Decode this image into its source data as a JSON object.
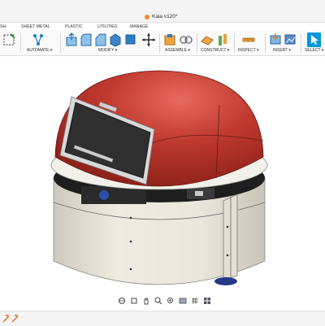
{
  "app": {
    "document_title": "Kaia v120*",
    "accent_color": "#0696d7"
  },
  "tabs": [
    {
      "label": "SH"
    },
    {
      "label": "SHEET METAL"
    },
    {
      "label": "PLASTIC"
    },
    {
      "label": "UTILITIES"
    },
    {
      "label": "MANAGE"
    }
  ],
  "toolbar_groups": [
    {
      "label": "AUTOMATE ▾"
    },
    {
      "label": "MODIFY ▾"
    },
    {
      "label": "ASSEMBLE ▾"
    },
    {
      "label": "CONSTRUCT ▾"
    },
    {
      "label": "INSPECT ▾"
    },
    {
      "label": "INSERT ▾"
    },
    {
      "label": "SELECT ▾"
    }
  ],
  "icons": {
    "toolbar": [
      "sketch-icon",
      "automate-icon",
      "press-pull-icon",
      "fillet-icon",
      "chamfer-icon",
      "shell-icon",
      "move-icon",
      "new-component-icon",
      "joint-icon",
      "offset-plane-icon",
      "axis-icon",
      "measure-icon",
      "insert-image-icon",
      "insert-canvas-icon",
      "select-icon"
    ],
    "navigation": [
      "orbit-icon",
      "look-at-icon",
      "pan-icon",
      "zoom-icon",
      "fit-icon",
      "display-settings-icon",
      "grid-icon",
      "viewports-icon"
    ],
    "timeline": [
      "timeline-feature-icon",
      "timeline-feature-icon-2"
    ]
  },
  "model": {
    "dome_color": "#b8362c",
    "body_color": "#eae5d8",
    "panel_color": "#2f2f30"
  }
}
